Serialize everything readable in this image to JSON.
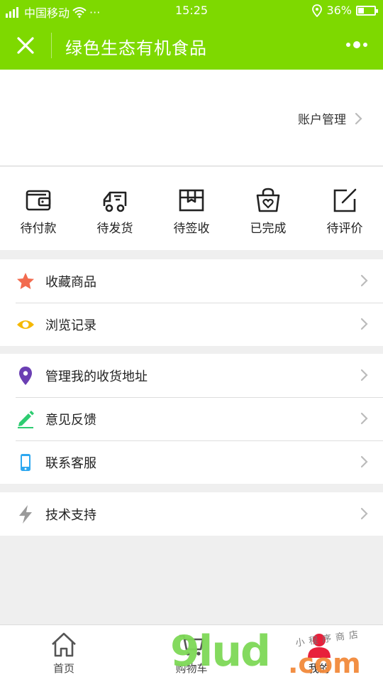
{
  "status_bar": {
    "carrier": "中国移动",
    "dots": "···",
    "time": "15:25",
    "battery": "36%",
    "battery_level": 0.36
  },
  "nav": {
    "title": "绿色生态有机食品",
    "close_icon": "close-icon",
    "more_icon": "more-icon"
  },
  "header": {
    "account_label": "账户管理"
  },
  "orders": [
    {
      "label": "待付款",
      "icon": "wallet-icon"
    },
    {
      "label": "待发货",
      "icon": "truck-icon"
    },
    {
      "label": "待签收",
      "icon": "package-icon"
    },
    {
      "label": "已完成",
      "icon": "bag-heart-icon"
    },
    {
      "label": "待评价",
      "icon": "edit-icon"
    }
  ],
  "menu_groups": [
    [
      {
        "label": "收藏商品",
        "icon": "star-icon",
        "color": "#f26b4f"
      },
      {
        "label": "浏览记录",
        "icon": "eye-icon",
        "color": "#f5b800"
      }
    ],
    [
      {
        "label": "管理我的收货地址",
        "icon": "location-pin-icon",
        "color": "#6b3fb3"
      },
      {
        "label": "意见反馈",
        "icon": "pencil-icon",
        "color": "#2ecc71"
      },
      {
        "label": "联系客服",
        "icon": "phone-icon",
        "color": "#2ea8f0"
      }
    ],
    [
      {
        "label": "技术支持",
        "icon": "lightning-icon",
        "color": "#9a9a9a"
      }
    ]
  ],
  "tabbar": [
    {
      "label": "首页",
      "icon": "home-icon"
    },
    {
      "label": "购物车",
      "icon": "cart-icon"
    },
    {
      "label": "我的",
      "icon": "user-icon",
      "active": true
    }
  ],
  "colors": {
    "brand": "#7ed900",
    "active_tab": "#e8203b"
  },
  "watermark": {
    "main": "9lud",
    "suffix": ".com",
    "sub": "小程序商店"
  }
}
